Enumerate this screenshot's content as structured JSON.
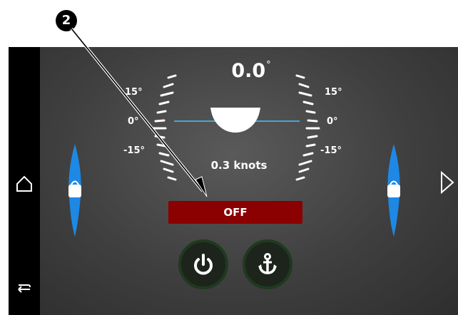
{
  "callout": {
    "number": "2"
  },
  "gauge": {
    "heading_value": "0.0",
    "heading_unit": "°",
    "left_labels": [
      "15°",
      "0°",
      "-15°"
    ],
    "right_labels": [
      "15°",
      "0°",
      "-15°"
    ],
    "speed": "0.3 knots"
  },
  "status": {
    "label": "OFF",
    "color": "#8b0000"
  },
  "controls": {
    "power_icon": "power-icon",
    "anchor_icon": "anchor-icon"
  },
  "nav": {
    "home_icon": "home-icon",
    "back_icon": "back-icon",
    "next_icon": "chevron-right-icon"
  },
  "colors": {
    "accent_blue": "#1e88e5",
    "waterline": "#4aa3d8"
  }
}
